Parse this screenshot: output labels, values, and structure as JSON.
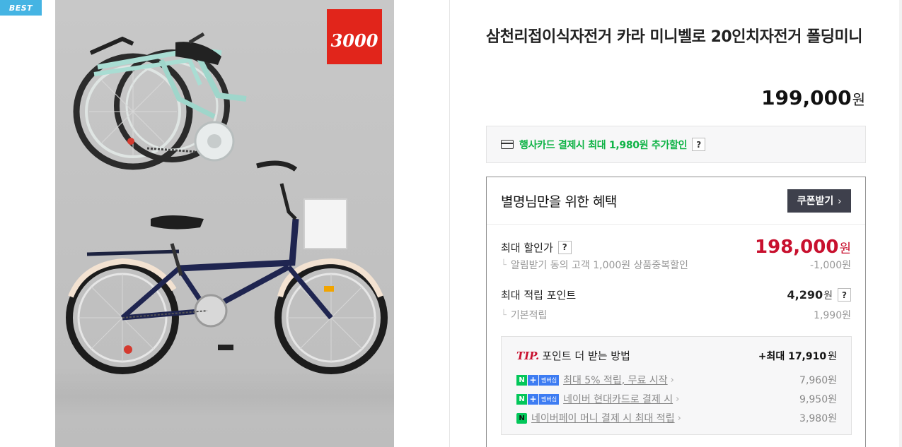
{
  "gallery": {
    "badge": "BEST",
    "brand_logo_text": "3000"
  },
  "product": {
    "title": "삼천리접이식자전거 카라 미니벨로 20인치자전거 폴딩미니",
    "price": "199,000",
    "currency": "원"
  },
  "card_promo": {
    "text": "행사카드 결제시 최대 1,980원 추가할인",
    "help": "?"
  },
  "benefit": {
    "title": "별명님만을 위한 혜택",
    "coupon_button": "쿠폰받기",
    "max_discount_label": "최대 할인가",
    "max_discount_help": "?",
    "max_discount_price": "198,000",
    "max_discount_currency": "원",
    "alarm_label": "알림받기 동의 고객 1,000원 상품중복할인",
    "alarm_value": "-1,000원",
    "points_label": "최대 적립 포인트",
    "points_value": "4,290",
    "points_currency": "원",
    "points_help": "?",
    "basic_label": "기본적립",
    "basic_value": "1,990원"
  },
  "tip": {
    "tip_word": "TIP.",
    "title": "포인트 더 받는 방법",
    "total_prefix": "+최대",
    "total_value": "17,910",
    "total_currency": "원",
    "rows": [
      {
        "badge_n": "N",
        "badge_plus": "+",
        "badge_mem": "멤버십",
        "label": "최대 5% 적립, 무료 시작",
        "value": "7,960원"
      },
      {
        "badge_n": "N",
        "badge_plus": "+",
        "badge_mem": "멤버십",
        "label": "네이버 현대카드로 결제 시",
        "value": "9,950원"
      },
      {
        "badge_pay": "N",
        "label": "네이버페이 머니 결제 시 최대 적립",
        "value": "3,980원"
      }
    ]
  },
  "colors": {
    "badge_blue": "#45b4e3",
    "discount_red": "#c8102e",
    "promo_green": "#0fb346",
    "naver_green": "#03c75a",
    "coupon_dark": "#3e404c",
    "logo_red": "#e1251b"
  },
  "icons": [
    "card-icon",
    "chevron-right-icon",
    "help-icon"
  ]
}
